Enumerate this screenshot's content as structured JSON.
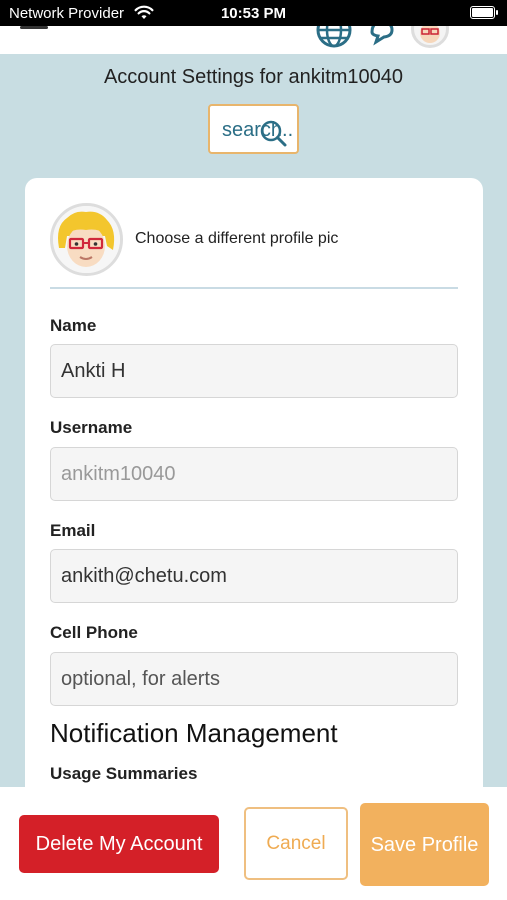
{
  "status_bar": {
    "carrier": "Network Provider",
    "time": "10:53 PM"
  },
  "header": {
    "title": "Account Settings for ankitm10040",
    "search_label": "search.."
  },
  "profile": {
    "change_pic_label": "Choose a different profile pic"
  },
  "fields": {
    "name": {
      "label": "Name",
      "value": "Ankti H"
    },
    "username": {
      "label": "Username",
      "value": "ankitm10040"
    },
    "email": {
      "label": "Email",
      "value": "ankith@chetu.com"
    },
    "cell_phone": {
      "label": "Cell Phone",
      "value": "",
      "placeholder": "optional, for alerts"
    }
  },
  "notifications": {
    "heading": "Notification Management",
    "usage_summaries_label": "Usage Summaries"
  },
  "actions": {
    "delete_label": "Delete My Account",
    "cancel_label": "Cancel",
    "save_label": "Save Profile"
  },
  "colors": {
    "background": "#c8dde2",
    "delete": "#d42028",
    "accent": "#f2b15e",
    "search_text": "#2b6e86"
  }
}
